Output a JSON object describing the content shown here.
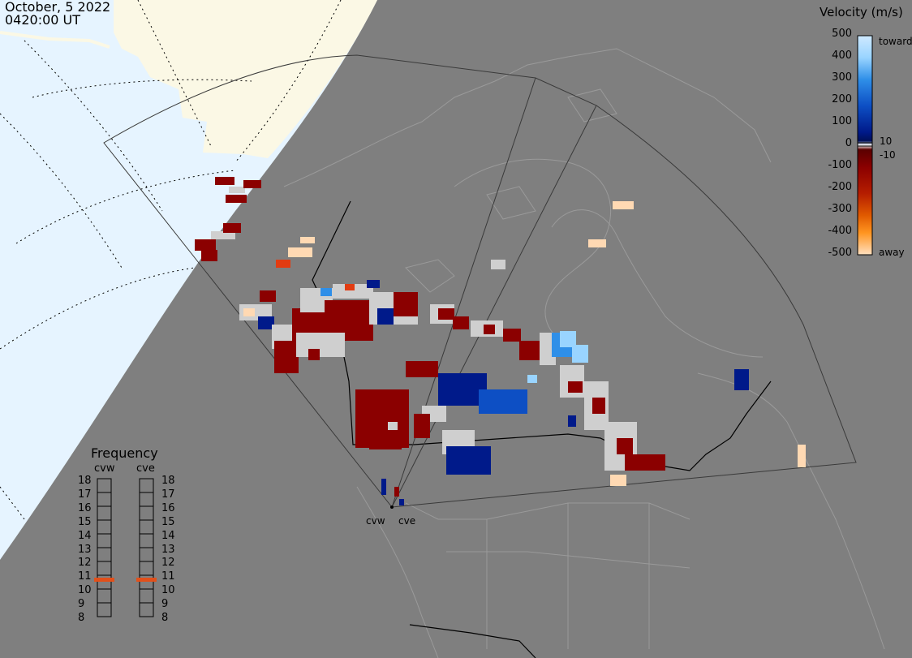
{
  "title": {
    "date": "October, 5 2022",
    "time": "0420:00 UT"
  },
  "legend": {
    "title": "Velocity (m/s)",
    "ticks": [
      "500",
      "400",
      "300",
      "200",
      "100",
      "0",
      "-100",
      "-200",
      "-300",
      "-400",
      "-500"
    ],
    "small_labels": [
      "10",
      "-10"
    ],
    "toward_label": "toward",
    "away_label": "away",
    "colors": {
      "toward_light": "#cfe9ff",
      "toward_mid": "#2f8fe8",
      "toward_dark": "#001a8a",
      "away_dark": "#8b0000",
      "away_mid": "#d84a10",
      "away_light": "#ffd9b3",
      "ground_scatter": "#cfcfcf"
    }
  },
  "frequency_panel": {
    "title": "Frequency",
    "radars": [
      {
        "name": "cvw",
        "frequency_mhz": 11
      },
      {
        "name": "cve",
        "frequency_mhz": 11
      }
    ],
    "scale_labels": [
      "18",
      "17",
      "16",
      "15",
      "14",
      "13",
      "12",
      "11",
      "10",
      "9",
      "8"
    ],
    "marker_color": "#e2501a"
  },
  "sites": [
    "cvw",
    "cve"
  ],
  "colors": {
    "night_background": "#7f7f7f",
    "day_ocean": "#e6f4ff",
    "day_land": "#fbf8e5"
  }
}
